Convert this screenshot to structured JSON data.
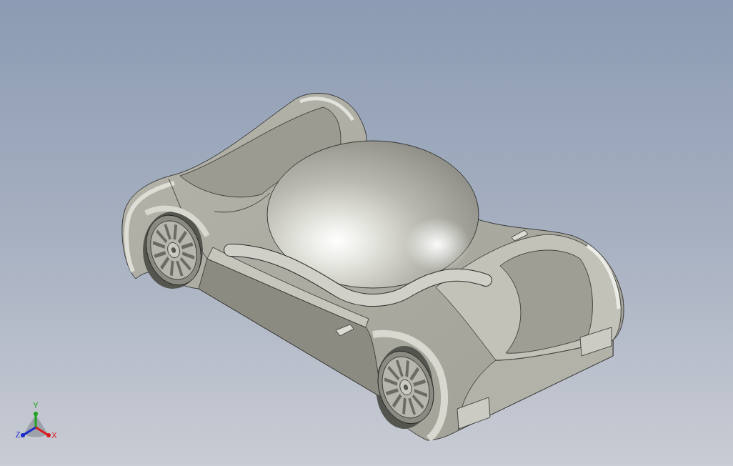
{
  "viewport": {
    "triad": {
      "axes": [
        {
          "kind": "y",
          "label": "Y",
          "color": "#1fa41f"
        },
        {
          "kind": "z",
          "label": "Z",
          "color": "#1c2ccc"
        },
        {
          "kind": "x",
          "label": "X",
          "color": "#d81c1c"
        }
      ]
    }
  }
}
